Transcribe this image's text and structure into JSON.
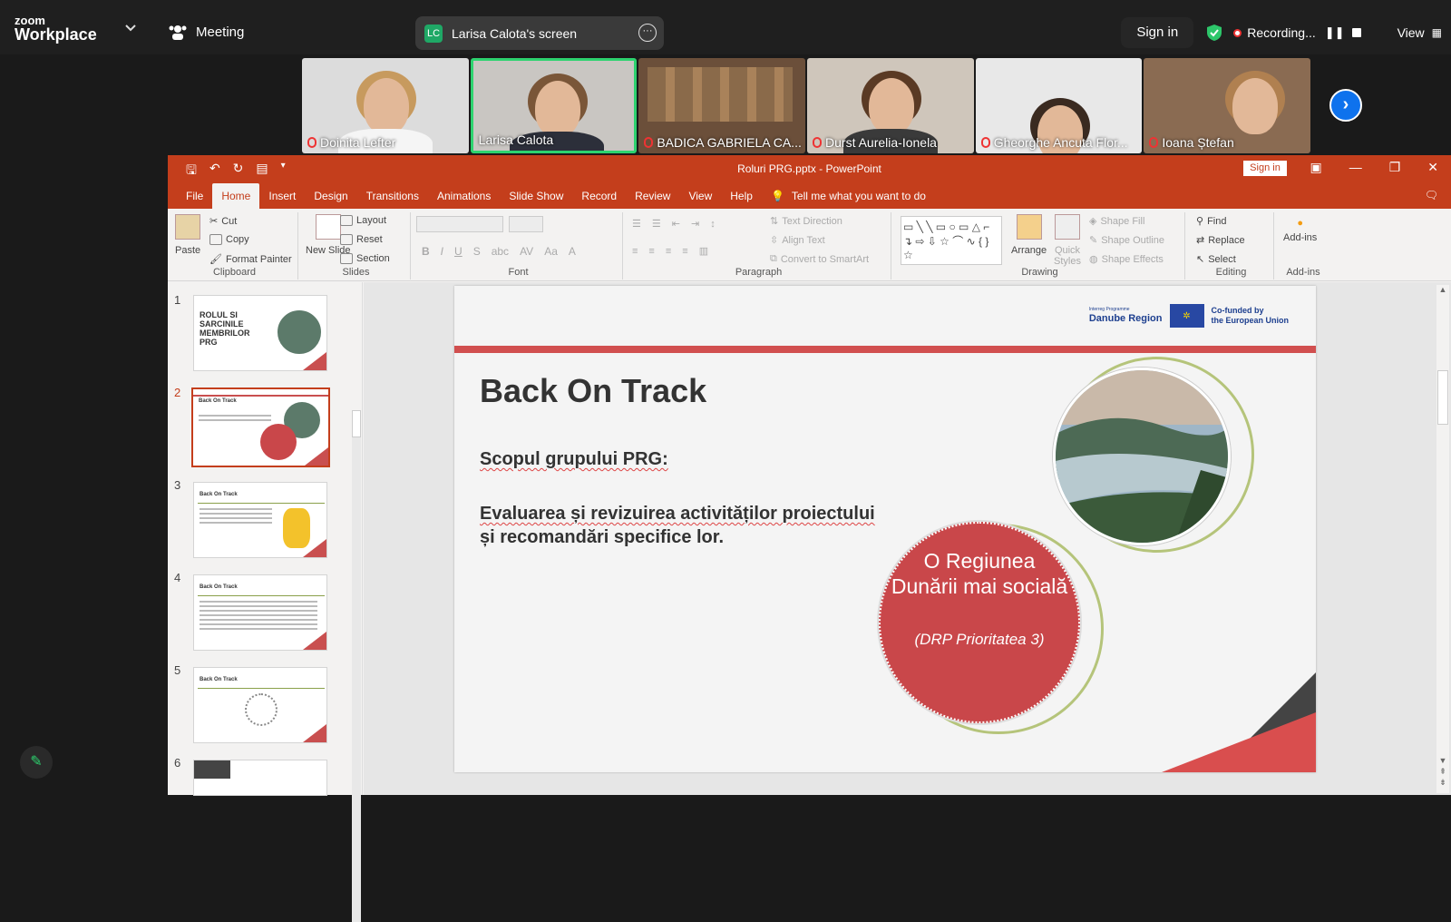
{
  "zoom": {
    "brand_top": "zoom",
    "brand_bottom": "Workplace",
    "meeting_label": "Meeting",
    "share_badge": "LC",
    "share_label": "Larisa Calota's screen",
    "sign_in": "Sign in",
    "recording": "Recording...",
    "view": "View"
  },
  "participants": [
    {
      "name": "Doinita Lefter",
      "muted": true,
      "active": false
    },
    {
      "name": "Larisa Calota",
      "muted": false,
      "active": true
    },
    {
      "name": "BADICA GABRIELA CA...",
      "muted": true,
      "active": false
    },
    {
      "name": "Durst Aurelia-Ionela",
      "muted": true,
      "active": false
    },
    {
      "name": "Gheorghe Ancuta Flor...",
      "muted": true,
      "active": false
    },
    {
      "name": "Ioana Ștefan",
      "muted": true,
      "active": false
    }
  ],
  "ppt": {
    "title": "Roluri PRG.pptx  -  PowerPoint",
    "sign_in": "Sign in",
    "tabs": [
      "File",
      "Home",
      "Insert",
      "Design",
      "Transitions",
      "Animations",
      "Slide Show",
      "Record",
      "Review",
      "View",
      "Help"
    ],
    "tell_me": "Tell me what you want to do",
    "ribbon": {
      "paste": "Paste",
      "cut": "Cut",
      "copy": "Copy",
      "format_painter": "Format Painter",
      "clipboard": "Clipboard",
      "new_slide": "New Slide",
      "layout": "Layout",
      "reset": "Reset",
      "section": "Section",
      "slides": "Slides",
      "font": "Font",
      "paragraph": "Paragraph",
      "text_direction": "Text Direction",
      "align_text": "Align Text",
      "convert_smartart": "Convert to SmartArt",
      "arrange": "Arrange",
      "quick_styles": "Quick Styles",
      "shape_fill": "Shape Fill",
      "shape_outline": "Shape Outline",
      "shape_effects": "Shape Effects",
      "drawing": "Drawing",
      "find": "Find",
      "replace": "Replace",
      "select": "Select",
      "editing": "Editing",
      "addins": "Add-ins",
      "addins_group": "Add-ins"
    },
    "thumbnails": [
      {
        "num": "1",
        "title": "ROLUL SI SARCINILE MEMBRILOR PRG"
      },
      {
        "num": "2",
        "title": "Back On Track"
      },
      {
        "num": "3",
        "title": "Back On Track"
      },
      {
        "num": "4",
        "title": "Back On Track"
      },
      {
        "num": "5",
        "title": "Back On Track"
      },
      {
        "num": "6",
        "title": ""
      }
    ],
    "slide": {
      "logo_small": "Interreg Programme",
      "logo_region": "Danube Region",
      "cofunded1": "Co-funded by",
      "cofunded2": "the European Union",
      "title": "Back On Track",
      "subtitle": "Scopul grupului PRG:",
      "body_line1": "Evaluarea și revizuirea activităților proiectului",
      "body_line2": "și recomandări specifice lor.",
      "circle_big": "O Regiunea Dunării mai socială",
      "circle_small": "(DRP Prioritatea 3)"
    }
  }
}
